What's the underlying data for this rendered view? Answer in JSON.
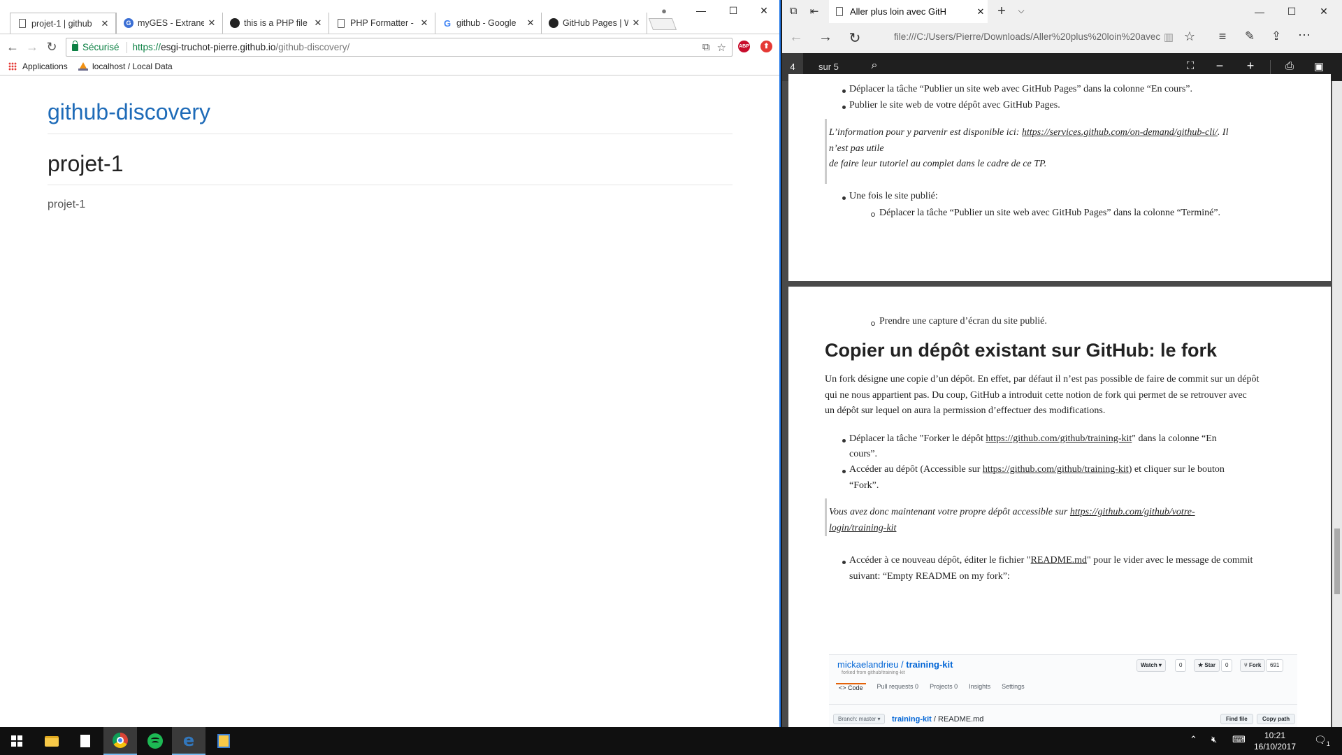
{
  "chrome": {
    "tabs": [
      {
        "title": "projet-1 | github",
        "icon": "document-icon"
      },
      {
        "title": "myGES - Extranet",
        "icon": "myges-icon"
      },
      {
        "title": "this is a PHP file",
        "icon": "github-icon"
      },
      {
        "title": "PHP Formatter -",
        "icon": "document-icon"
      },
      {
        "title": "github - Google",
        "icon": "google-icon"
      },
      {
        "title": "GitHub Pages | W",
        "icon": "github-icon"
      }
    ],
    "tab_close": "✕",
    "window": {
      "minimize": "—",
      "maximize": "☐",
      "close": "✕"
    },
    "address": {
      "secure_label": "Sécurisé",
      "url_prefix": "https://",
      "url_host": "esgi-truchot-pierre.github.io",
      "url_path": "/github-discovery/"
    },
    "extensions": [
      {
        "label": "ABP",
        "color": "#c70d2c"
      },
      {
        "label": "⬆",
        "color": "#e53935"
      }
    ],
    "bookmarks": [
      {
        "label": "Applications"
      },
      {
        "label": "localhost / Local Data"
      }
    ],
    "page": {
      "site_title": "github-discovery",
      "heading": "projet-1",
      "paragraph": "projet-1"
    }
  },
  "edge": {
    "tab_title": "Aller plus loin avec GitH",
    "tab_close": "✕",
    "new_tab": "+",
    "tab_menu": "⌵",
    "window": {
      "minimize": "—",
      "maximize": "☐",
      "close": "✕"
    },
    "url": "file:///C:/Users/Pierre/Downloads/Aller%20plus%20loin%20avec",
    "pdf": {
      "page_current": "4",
      "page_total": "sur 5"
    },
    "page4": {
      "item1": "Déplacer la tâche “Publier un site web avec GitHub Pages” dans la colonne “En cours”.",
      "item2": "Publier le site web de votre dépôt avec GitHub Pages.",
      "quote_line1_text": "L’information pour y parvenir est disponible ici: ",
      "quote_line1_link": "https://services.github.com/on-demand/github-cli/",
      "quote_line1_tail": ". Il",
      "quote_line2": "n’est pas utile",
      "quote_line3": "de faire leur tutoriel au complet dans le cadre de ce TP.",
      "item3": "Une fois le site publié:",
      "subitem1": "Déplacer la tâche “Publier un site web avec GitHub Pages” dans la colonne “Terminé”."
    },
    "page5": {
      "subitem2": "Prendre une capture d’écran du site publié.",
      "heading": "Copier un dépôt existant sur GitHub: le fork",
      "para_line1": "Un fork désigne une copie d’un dépôt. En effet, par défaut il n’est pas possible de faire de commit sur un dépôt",
      "para_line2": "qui ne nous appartient pas. Du coup, GitHub a introduit cette notion de fork qui permet de se retrouver avec",
      "para_line3": "un dépôt sur lequel on aura la permission d’effectuer des modifications.",
      "b1_pre": "Déplacer la tâche \"Forker le dépôt ",
      "b1_link": "https://github.com/github/training-kit",
      "b1_post": "\" dans la colonne “En",
      "b1_line2": "cours”.",
      "b2_pre": "Accéder au dépôt (Accessible sur ",
      "b2_link": "https://github.com/github/training-kit",
      "b2_post": ") et cliquer sur le bouton",
      "b2_line2": "“Fork”.",
      "q_pre": "Vous avez donc maintenant votre propre dépôt accessible sur ",
      "q_link1": "https://github.com/github/votre-",
      "q_link2": "login/training-kit",
      "b3_pre": "Accéder à ce nouveau dépôt, éditer le fichier \"",
      "b3_link": "README.md",
      "b3_post": "\" pour le vider avec le message de commit",
      "b3_line2": "suivant: “Empty README on my fork”:",
      "gh": {
        "owner": "mickaelandrieu",
        "repo": "training-kit",
        "forked_from": "forked from github/training-kit",
        "watch": "Watch ▾",
        "watch_count": "0",
        "star": "Star",
        "star_count": "0",
        "fork": "Fork",
        "fork_count": "691",
        "tabs": [
          "<> Code",
          "Pull requests 0",
          "Projects 0",
          "Insights",
          "Settings"
        ],
        "branch": "Branch: master ▾",
        "path_repo": "training-kit",
        "path_file": " / README.md",
        "find_file": "Find file",
        "copy_path": "Copy path"
      }
    }
  },
  "taskbar": {
    "time": "10:21",
    "date": "16/10/2017",
    "notification_count": "1"
  }
}
